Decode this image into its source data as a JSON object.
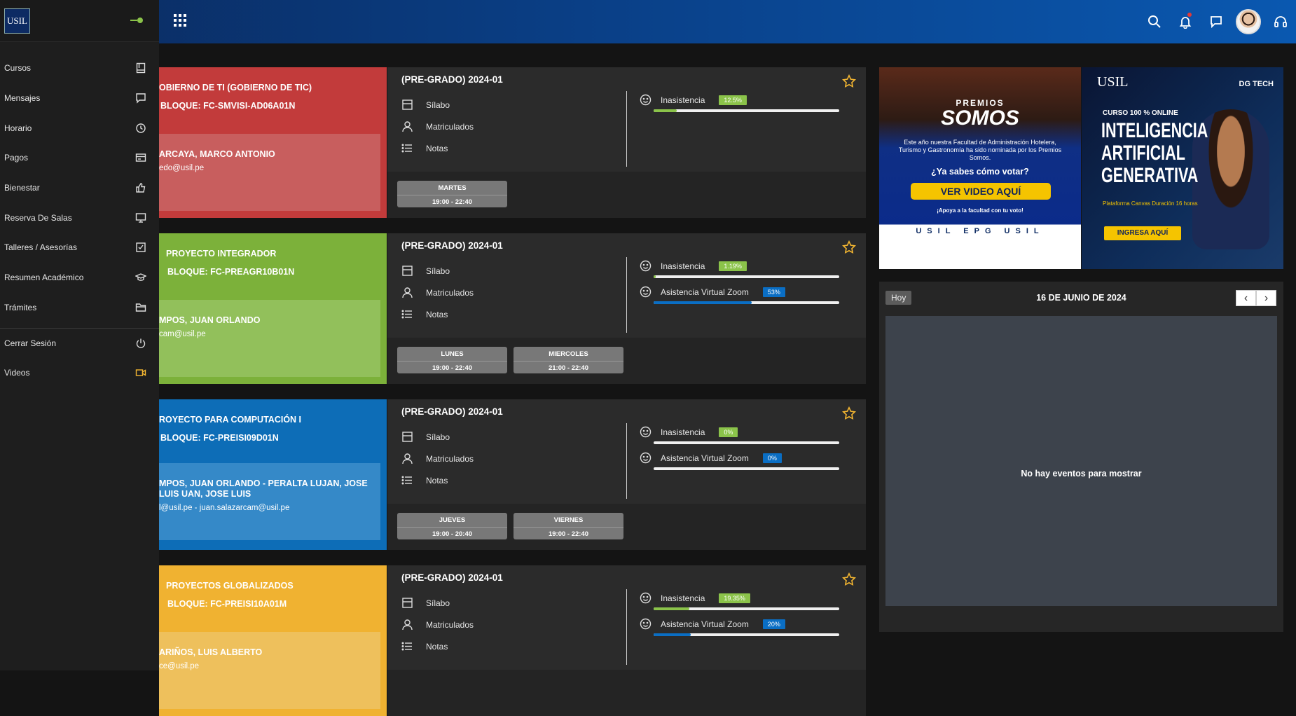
{
  "brand": {
    "logo_text": "USIL"
  },
  "colors": {
    "accent_green": "#8bc34a",
    "accent_blue": "#0a6ec4",
    "accent_yellow": "#f5b731",
    "accent_red": "#c23b3b"
  },
  "sidebar": {
    "items": [
      {
        "label": "Cursos",
        "icon": "book-icon"
      },
      {
        "label": "Mensajes",
        "icon": "chat-icon"
      },
      {
        "label": "Horario",
        "icon": "clock-icon"
      },
      {
        "label": "Pagos",
        "icon": "card-icon"
      },
      {
        "label": "Bienestar",
        "icon": "thumbs-up-icon"
      },
      {
        "label": "Reserva De Salas",
        "icon": "monitor-icon"
      },
      {
        "label": "Talleres / Asesorías",
        "icon": "checkbox-icon"
      },
      {
        "label": "Resumen Académico",
        "icon": "graduation-cap-icon"
      },
      {
        "label": "Trámites",
        "icon": "folder-icon"
      },
      {
        "label": "Cerrar Sesión",
        "icon": "power-icon"
      },
      {
        "label": "Videos",
        "icon": "video-icon"
      }
    ]
  },
  "courses": [
    {
      "color": "#c23b3b",
      "prof_bg": "#c85e5e",
      "name": "OBIERNO DE TI (GOBIERNO DE TIC)",
      "block": "BLOQUE: FC-SMVISI-AD06A01N",
      "professor": "ARCAYA, MARCO ANTONIO",
      "email": "edo@usil.pe",
      "semester": "(PRE-GRADO) 2024-01",
      "links": [
        "Sílabo",
        "Matriculados",
        "Notas"
      ],
      "stats": [
        {
          "label": "Inasistencia",
          "value": "12.5%",
          "pct": 12.5,
          "color": "#8bc34a"
        }
      ],
      "days": [
        {
          "day": "MARTES",
          "time": "19:00 - 22:40"
        }
      ]
    },
    {
      "color": "#7cb13a",
      "prof_bg": "#92c05b",
      "name": "PROYECTO INTEGRADOR",
      "block": "BLOQUE: FC-PREAGR10B01N",
      "professor": "MPOS, JUAN ORLANDO",
      "email": "cam@usil.pe",
      "semester": "(PRE-GRADO) 2024-01",
      "links": [
        "Sílabo",
        "Matriculados",
        "Notas"
      ],
      "stats": [
        {
          "label": "Inasistencia",
          "value": "1.19%",
          "pct": 1.19,
          "color": "#8bc34a"
        },
        {
          "label": "Asistencia Virtual Zoom",
          "value": "53%",
          "pct": 53,
          "color": "#0a6ec4"
        }
      ],
      "days": [
        {
          "day": "LUNES",
          "time": "19:00 - 22:40"
        },
        {
          "day": "MIERCOLES",
          "time": "21:00 - 22:40"
        }
      ]
    },
    {
      "color": "#0d6db7",
      "prof_bg": "#3589c8",
      "name": "ROYECTO PARA COMPUTACIÓN I",
      "block": "BLOQUE: FC-PREISI09D01N",
      "professor": "MPOS, JUAN ORLANDO - PERALTA LUJAN, JOSE LUIS UAN, JOSE LUIS",
      "email": "l@usil.pe - juan.salazarcam@usil.pe",
      "semester": "(PRE-GRADO) 2024-01",
      "links": [
        "Sílabo",
        "Matriculados",
        "Notas"
      ],
      "stats": [
        {
          "label": "Inasistencia",
          "value": "0%",
          "pct": 0,
          "color": "#8bc34a"
        },
        {
          "label": "Asistencia Virtual Zoom",
          "value": "0%",
          "pct": 0,
          "color": "#0a6ec4"
        }
      ],
      "days": [
        {
          "day": "JUEVES",
          "time": "19:00 - 20:40"
        },
        {
          "day": "VIERNES",
          "time": "19:00 - 22:40"
        }
      ]
    },
    {
      "color": "#f0b231",
      "prof_bg": "#eec05c",
      "name": "PROYECTOS GLOBALIZADOS",
      "block": "BLOQUE: FC-PREISI10A01M",
      "professor": "ARIÑOS, LUIS ALBERTO",
      "email": "ce@usil.pe",
      "semester": "(PRE-GRADO) 2024-01",
      "links": [
        "Sílabo",
        "Matriculados",
        "Notas"
      ],
      "stats": [
        {
          "label": "Inasistencia",
          "value": "19.35%",
          "pct": 19.35,
          "color": "#8bc34a"
        },
        {
          "label": "Asistencia Virtual Zoom",
          "value": "20%",
          "pct": 20,
          "color": "#0a6ec4"
        }
      ],
      "days": []
    }
  ],
  "banner1": {
    "title_top": "PREMIOS",
    "title_main": "SOMOS",
    "desc": "Este año nuestra Facultad de Administración Hotelera, Turismo y Gastronomía ha sido nominada por los Premios Somos.",
    "question": "¿Ya sabes cómo votar?",
    "button": "VER VIDEO AQUÍ",
    "support": "¡Apoya a la facultad con tu voto!",
    "logos": "USIL EPG USIL"
  },
  "banner2": {
    "logo": "USIL",
    "brand": "DG TECH",
    "course_type": "CURSO 100 % ONLINE",
    "title": "INTELIGENCIA ARTIFICIAL GENERATIVA",
    "details": "Plataforma Canvas   Duración 16 horas",
    "button": "INGRESA AQUÍ"
  },
  "calendar": {
    "today_label": "Hoy",
    "title": "16 DE JUNIO DE 2024",
    "prev": "‹",
    "next": "›",
    "empty": "No hay eventos para mostrar"
  }
}
